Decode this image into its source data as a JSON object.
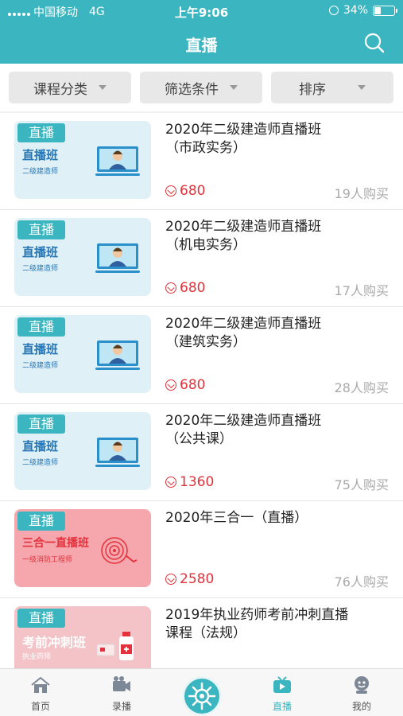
{
  "status_bar": {
    "carrier": "中国移动",
    "network": "4G",
    "time": "上午9:06",
    "battery": "34%",
    "battery_level": 0.34
  },
  "header": {
    "title": "直播",
    "search_icon": "search-icon"
  },
  "filters": [
    {
      "label": "课程分类"
    },
    {
      "label": "筛选条件"
    },
    {
      "label": "排序"
    }
  ],
  "courses": [
    {
      "tag": "直播",
      "thumb_title": "直播班",
      "thumb_sub": "二级建造师",
      "title_line1": "2020年二级建造师直播班",
      "title_line2": "（市政实务）",
      "price": "680",
      "buyers": "19人购买"
    },
    {
      "tag": "直播",
      "thumb_title": "直播班",
      "thumb_sub": "二级建造师",
      "title_line1": "2020年二级建造师直播班",
      "title_line2": "（机电实务）",
      "price": "680",
      "buyers": "17人购买"
    },
    {
      "tag": "直播",
      "thumb_title": "直播班",
      "thumb_sub": "二级建造师",
      "title_line1": "2020年二级建造师直播班",
      "title_line2": "（建筑实务）",
      "price": "680",
      "buyers": "28人购买"
    },
    {
      "tag": "直播",
      "thumb_title": "直播班",
      "thumb_sub": "二级建造师",
      "title_line1": "2020年二级建造师直播班",
      "title_line2": "（公共课）",
      "price": "1360",
      "buyers": "75人购买"
    },
    {
      "tag": "直播",
      "thumb_title": "三合一直播班",
      "thumb_sub": "一级消防工程师",
      "title_line1": "2020年三合一（直播）",
      "title_line2": "",
      "price": "2580",
      "buyers": "76人购买"
    },
    {
      "tag": "直播",
      "thumb_title": "考前冲刺班",
      "thumb_sub": "执业药师",
      "title_line1": "2019年执业药师考前冲刺直播",
      "title_line2": "课程（法规）",
      "price": "",
      "buyers": ""
    }
  ],
  "tabs": [
    {
      "label": "首页",
      "icon": "home-icon"
    },
    {
      "label": "录播",
      "icon": "video-camera-icon"
    },
    {
      "label": "",
      "icon": "helm-icon"
    },
    {
      "label": "直播",
      "icon": "tv-icon"
    },
    {
      "label": "我的",
      "icon": "profile-icon"
    }
  ],
  "colors": {
    "accent": "#3bb6c1",
    "price": "#e3323c",
    "muted": "#aaaaaa"
  }
}
